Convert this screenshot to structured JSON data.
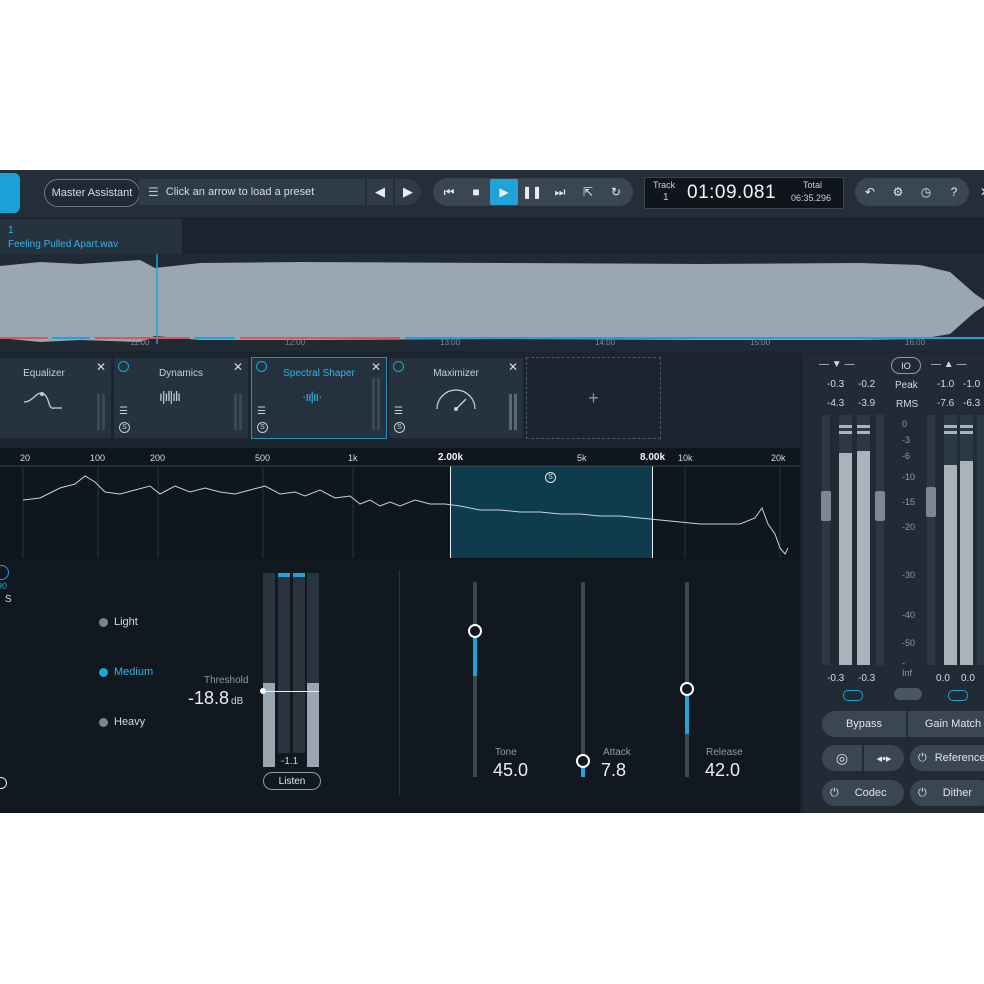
{
  "header": {
    "master_assistant": "Master Assistant",
    "preset_placeholder": "Click an arrow to load a preset",
    "track_label": "Track",
    "track_number": "1",
    "time": "01:09.081",
    "total_label": "Total",
    "total_time": "06:35.296"
  },
  "file_tab": {
    "index": "1",
    "filename": "Feeling Pulled Apart.wav"
  },
  "timeline": {
    "ticks": [
      "11:00",
      "12:00",
      "13:00",
      "14:00",
      "15:00",
      "16:00"
    ]
  },
  "modules": [
    {
      "name": "Equalizer",
      "icon": "eq-curve-icon"
    },
    {
      "name": "Dynamics",
      "icon": "dynamics-bars-icon"
    },
    {
      "name": "Spectral Shaper",
      "icon": "spectral-icon",
      "selected": true
    },
    {
      "name": "Maximizer",
      "icon": "gauge-icon"
    }
  ],
  "add_module": "+",
  "spectrum": {
    "freq_labels": [
      "20",
      "100",
      "200",
      "500",
      "1k",
      "2.00k",
      "5k",
      "8.00k",
      "10k",
      "20k"
    ],
    "band_low": "2.00k",
    "band_high": "8.00k",
    "band_solo": "S"
  },
  "controls": {
    "left_partial_top": "90",
    "left_partial_s": "S",
    "modes": [
      "Light",
      "Medium",
      "Heavy"
    ],
    "selected_mode": "Medium",
    "threshold_label": "Threshold",
    "threshold_value": "-18.8",
    "threshold_unit": "dB",
    "gr_value": "-1.1",
    "listen": "Listen",
    "tone_label": "Tone",
    "tone_value": "45.0",
    "tone_level": 0.75,
    "attack_label": "Attack",
    "attack_value": "7.8",
    "attack_level": 0.08,
    "release_label": "Release",
    "release_value": "42.0",
    "release_level": 0.45
  },
  "meters": {
    "in_peak": [
      "-0.3",
      "-0.2"
    ],
    "in_rms": [
      "-4.3",
      "-3.9"
    ],
    "io": "IO",
    "peak_label": "Peak",
    "rms_label": "RMS",
    "out_peak": [
      "-1.0",
      "-1.0"
    ],
    "out_rms": [
      "-7.6",
      "-6.3"
    ],
    "scale": [
      "0",
      "-3",
      "-6",
      "-10",
      "-15",
      "-20",
      "-30",
      "-40",
      "-50",
      "-Inf"
    ],
    "in_bottom": [
      "-0.3",
      "-0.3"
    ],
    "out_bottom": [
      "0.0",
      "0.0"
    ]
  },
  "footer_buttons": {
    "bypass": "Bypass",
    "gain_match": "Gain Match",
    "reference": "Reference",
    "codec": "Codec",
    "dither": "Dither"
  },
  "colors": {
    "accent": "#1fa3d8",
    "panel": "#1b2530",
    "waveform": "#9aa6b1",
    "selection": "#0f3c4c"
  }
}
